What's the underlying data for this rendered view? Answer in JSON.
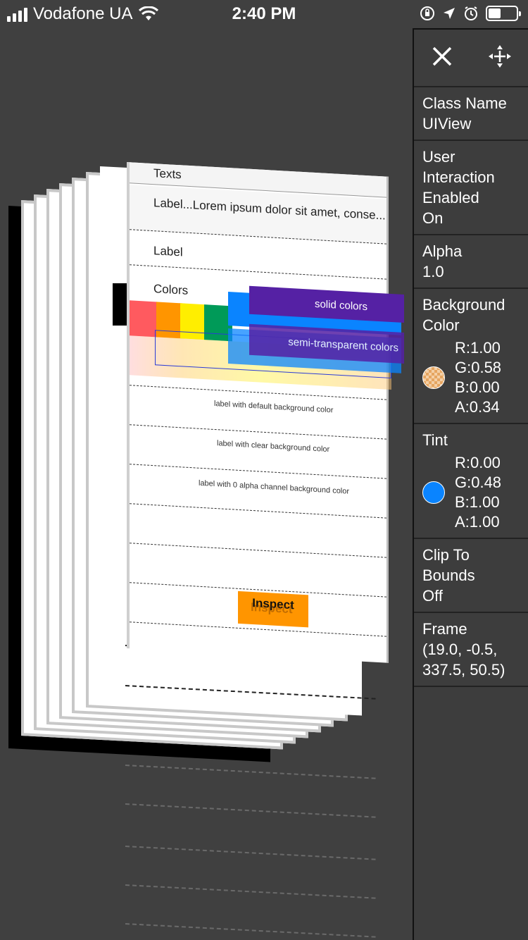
{
  "status_bar": {
    "carrier": "Vodafone UA",
    "time": "2:40 PM",
    "icons": [
      "signal-icon",
      "wifi-icon",
      "orientation-lock-icon",
      "location-icon",
      "alarm-icon",
      "battery-icon"
    ]
  },
  "scene": {
    "front_layer": {
      "section_texts": "Texts",
      "label_long": "Label...Lorem ipsum dolor sit amet, conse...",
      "label": "Label",
      "section_colors": "Colors",
      "solid_colors": "solid colors",
      "semi_transparent_colors": "semi-transparent colors",
      "label_default_bg": "label with default background color",
      "label_clear_bg": "label with clear background color",
      "label_zero_alpha_bg": "label with 0 alpha channel background color",
      "inspect_button": "Inspect",
      "inspect_ghost": "Inspect"
    },
    "swatch_colors": [
      "#ff5a5f",
      "#ff9500",
      "#ffee00",
      "#009a58",
      "#0a84ff",
      "#5521a4"
    ]
  },
  "inspector": {
    "close_icon": "close-icon",
    "move_icon": "move-arrows-icon",
    "class_name": {
      "label": "Class Name",
      "value": "UIView"
    },
    "user_interaction": {
      "label": "User Interaction Enabled",
      "value": "On"
    },
    "alpha": {
      "label": "Alpha",
      "value": "1.0"
    },
    "background_color": {
      "label": "Background Color",
      "r": "R:1.00",
      "g": "G:0.58",
      "b": "B:0.00",
      "a": "A:0.34"
    },
    "tint": {
      "label": "Tint",
      "r": "R:0.00",
      "g": "G:0.48",
      "b": "B:1.00",
      "a": "A:1.00",
      "color": "#0a84ff"
    },
    "clip_to_bounds": {
      "label": "Clip To Bounds",
      "value": "Off"
    },
    "frame": {
      "label": "Frame",
      "value": "(19.0, -0.5, 337.5, 50.5)"
    }
  }
}
